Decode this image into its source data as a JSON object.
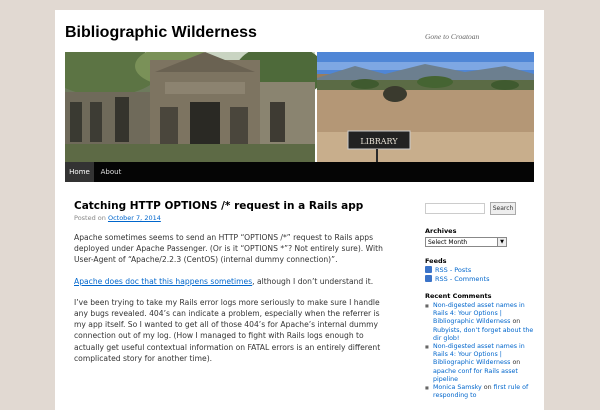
{
  "site": {
    "title": "Bibliographic Wilderness",
    "tagline": "Gone to Croatoan"
  },
  "banner": {
    "sign_text": "LIBRARY"
  },
  "menu": {
    "items": [
      {
        "label": "Home",
        "active": true
      },
      {
        "label": "About",
        "active": false
      }
    ]
  },
  "post": {
    "title": "Catching HTTP OPTIONS /* request in a Rails app",
    "posted_on_label": "Posted on",
    "date": "October 7, 2014",
    "p1": "Apache sometimes seems to send an HTTP “OPTIONS /*” request to Rails apps deployed under Apache Passenger.  (Or is it “OPTIONS *”? Not entirely sure). With User-Agent of “Apache/2.2.3 (CentOS) (internal dummy connection)”.",
    "p2_link": "Apache does doc that this happens sometimes",
    "p2_rest": ", although I don’t understand it.",
    "p3": "I’ve been trying to take my Rails error logs more seriously to make sure I handle any bugs revealed. 404’s can indicate a problem, especially when the referrer is my app itself. So I wanted to get all of those 404’s for Apache’s internal dummy connection out of my log.  (How I managed to fight with Rails logs enough to actually get useful contextual information on FATAL errors is an entirely different complicated story for another time)."
  },
  "sidebar": {
    "search_button": "Search",
    "search_value": "",
    "archives_title": "Archives",
    "archives_selected": "Select Month",
    "feeds_title": "Feeds",
    "rss_posts": "RSS - Posts",
    "rss_comments": "RSS - Comments",
    "recent_comments_title": "Recent Comments",
    "recent_comments": [
      {
        "author": "Non-digested asset names in Rails 4: Your Options | Bibliographic Wilderness",
        "on": "on",
        "post": "Rubyists, don’t forget about the dir glob!"
      },
      {
        "author": "Non-digested asset names in Rails 4: Your Options | Bibliographic Wilderness",
        "on": "on",
        "post": "apache conf for Rails asset pipeline"
      },
      {
        "author": "Monica Samsky",
        "on": "on",
        "post": "first rule of responding to"
      }
    ]
  },
  "colors": {
    "page_bg": "#e1d9d2",
    "link": "#0066cc",
    "menu_bg": "#050505"
  }
}
